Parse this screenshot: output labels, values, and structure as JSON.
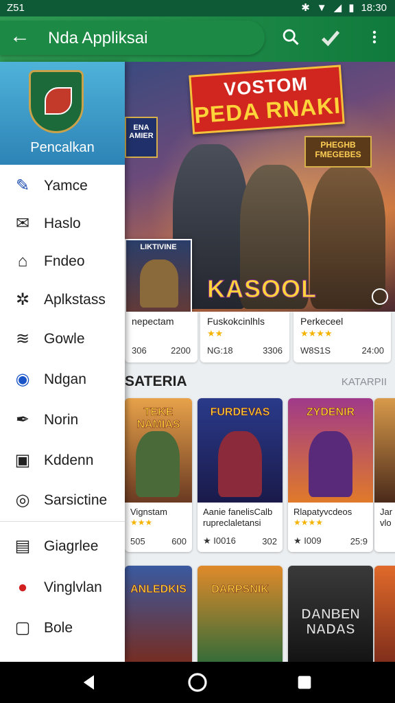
{
  "status": {
    "time_left": "Z51",
    "time_right": "18:30"
  },
  "appbar": {
    "title": "Nda Appliksai"
  },
  "drawer": {
    "header_name": "Pencalkan",
    "items": [
      {
        "label": "Yamce",
        "icon": "brush-icon"
      },
      {
        "label": "Haslo",
        "icon": "mail-icon"
      },
      {
        "label": "Fndeo",
        "icon": "store-icon"
      },
      {
        "label": "Aplkstass",
        "icon": "puzzle-icon"
      },
      {
        "label": "Gowle",
        "icon": "signal-icon"
      },
      {
        "label": "Ndgan",
        "icon": "circle-icon"
      },
      {
        "label": "Norin",
        "icon": "pen-icon"
      },
      {
        "label": "Kddenn",
        "icon": "frame-icon"
      },
      {
        "label": "Sarsictine",
        "icon": "account-icon"
      },
      {
        "label": "Giagrlee",
        "icon": "save-icon"
      },
      {
        "label": "Vinglvlan",
        "icon": "red-badge-icon"
      },
      {
        "label": "Bole",
        "icon": "square-icon"
      }
    ]
  },
  "banner": {
    "ribbon_line1": "VOSTOM",
    "ribbon_line2": "PEDA RNAKI",
    "badge_left": "ENA AMIER",
    "badge_right_1": "PHEGHB",
    "badge_right_2": "FMEGEBES",
    "logo": "KASOOL",
    "mini_card_title": "LIKTIVINE"
  },
  "featured": [
    {
      "name": "nepectam",
      "stars": "",
      "left": "306",
      "right": "2200"
    },
    {
      "name": "Fuskokcinlhls",
      "stars": "★★",
      "left": "NG:18",
      "right": "3306"
    },
    {
      "name": "Perkeceel",
      "stars": "★★★★",
      "left": "W8S1S",
      "right": "24:00"
    }
  ],
  "section": {
    "title": "SATERIA",
    "link": "KATARPII"
  },
  "grid_row1": [
    {
      "art_title": "TEKE NAMIAS",
      "name": "Vignstam",
      "stars": "★★★",
      "left": "505",
      "right": "600"
    },
    {
      "art_title": "FURDEVAS",
      "name": "Aanie fanelisCalb rupreclaletansi",
      "stars": "",
      "left": "★ I0016",
      "right": "302"
    },
    {
      "art_title": "ZYDENIR",
      "name": "Rlapatyvcdeos",
      "stars": "★★★★",
      "left": "★ I009",
      "right": "25:9"
    },
    {
      "art_title": "",
      "name": "Jar vlo",
      "stars": "",
      "left": "",
      "right": ""
    }
  ],
  "grid_row2": [
    {
      "art_title": "ANLEDKIS"
    },
    {
      "art_title": "DARPSNIK"
    },
    {
      "art_title": "DANBEN NADAS"
    },
    {
      "art_title": ""
    }
  ]
}
